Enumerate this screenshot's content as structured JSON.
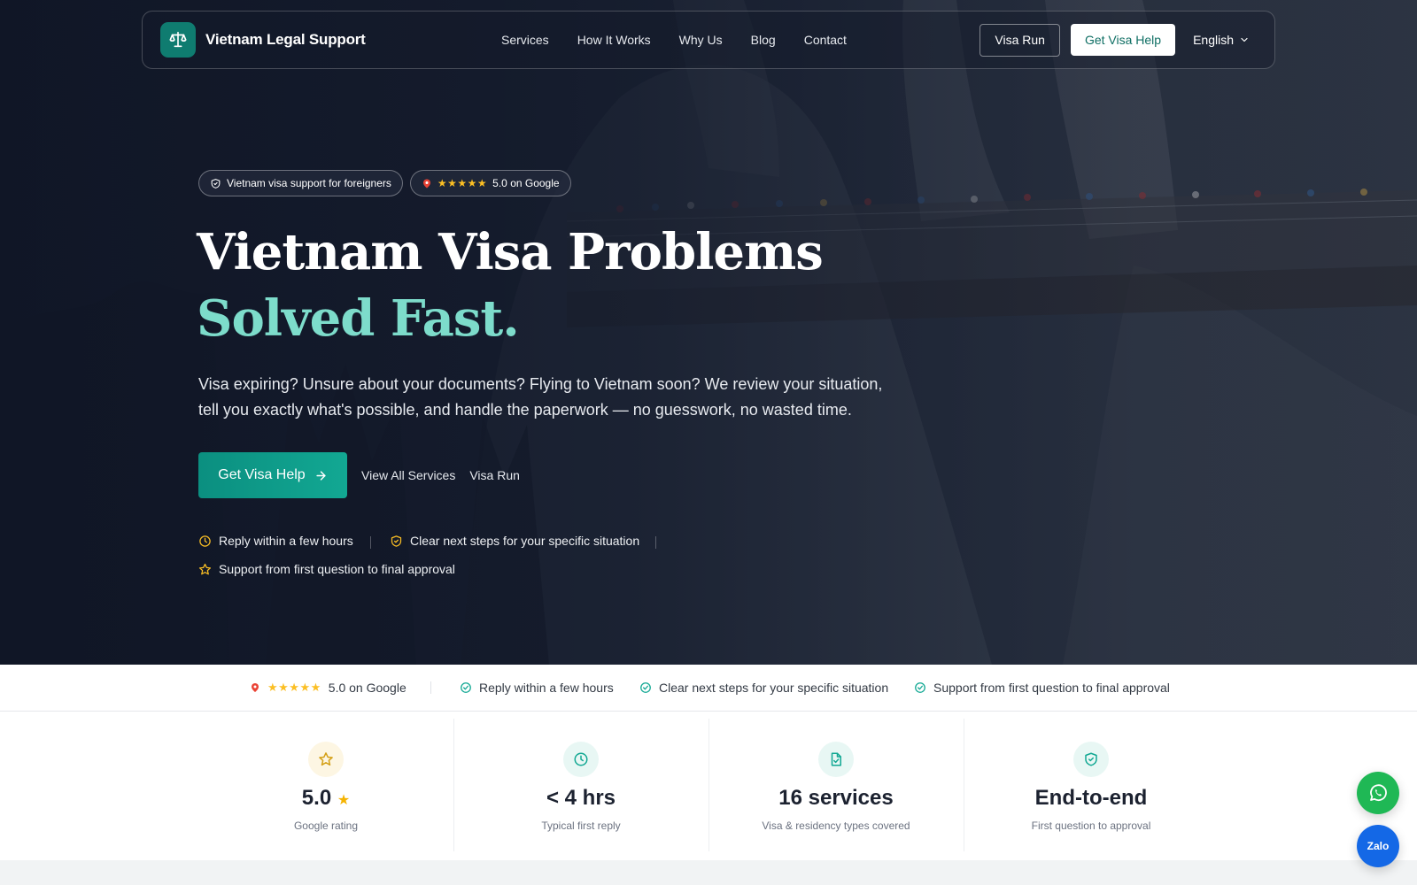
{
  "nav": {
    "brand": "Vietnam Legal Support",
    "links": [
      "Services",
      "How It Works",
      "Why Us",
      "Blog",
      "Contact"
    ],
    "visa_run": "Visa Run",
    "cta": "Get Visa Help",
    "language": "English"
  },
  "hero": {
    "pills": {
      "support": "Vietnam visa support for foreigners",
      "stars": "★★★★★",
      "rating": "5.0 on Google"
    },
    "headline": {
      "main": "Vietnam Visa Problems ",
      "accent": "Solved Fast."
    },
    "subtext": "Visa expiring? Unsure about your documents? Flying to Vietnam soon? We review your situation, tell you exactly what's possible, and handle the paperwork — no guesswork, no wasted time.",
    "cta_primary": "Get Visa Help",
    "cta_services": "View All Services",
    "cta_visa_run": "Visa Run",
    "features": [
      "Reply within a few hours",
      "Clear next steps for your specific situation",
      "Support from first question to final approval"
    ]
  },
  "trust": {
    "stars": "★★★★★",
    "rating": "5.0 on Google",
    "items": [
      "Reply within a few hours",
      "Clear next steps for your specific situation",
      "Support from first question to final approval"
    ]
  },
  "stats": [
    {
      "value": "5.0",
      "suffix": "★",
      "label": "Google rating",
      "icon": "star-icon"
    },
    {
      "value": "< 4 hrs",
      "suffix": "",
      "label": "Typical first reply",
      "icon": "clock-icon"
    },
    {
      "value": "16 services",
      "suffix": "",
      "label": "Visa & residency types covered",
      "icon": "document-check-icon"
    },
    {
      "value": "End-to-end",
      "suffix": "",
      "label": "First question to approval",
      "icon": "shield-check-icon"
    }
  ],
  "floating": {
    "zalo": "Zalo"
  },
  "colors": {
    "accent": "#7ddccb",
    "primary": "#0f7c70",
    "star": "#fbbf24",
    "whatsapp": "#1fb855",
    "zalo": "#1468e6"
  }
}
